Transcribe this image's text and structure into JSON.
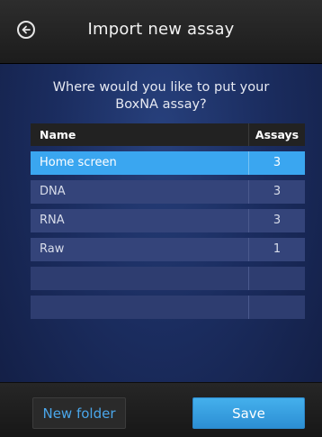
{
  "header": {
    "title": "Import new assay",
    "back_icon": "arrow-left-circle-icon"
  },
  "prompt": {
    "line1": "Where would you like to put your",
    "line2": "BoxNA assay?"
  },
  "table": {
    "columns": [
      "Name",
      "Assays"
    ],
    "rows": [
      {
        "name": "Home screen",
        "count": "3",
        "selected": true
      },
      {
        "name": "DNA",
        "count": "3"
      },
      {
        "name": "RNA",
        "count": "3"
      },
      {
        "name": "Raw",
        "count": "1"
      },
      {
        "name": "",
        "count": ""
      },
      {
        "name": "",
        "count": ""
      }
    ]
  },
  "footer": {
    "new_folder_label": "New folder",
    "save_label": "Save"
  },
  "colors": {
    "selected_row": "#3aa6f0",
    "save_button": "#3aa6f0",
    "new_folder_text": "#4aa6ea"
  }
}
